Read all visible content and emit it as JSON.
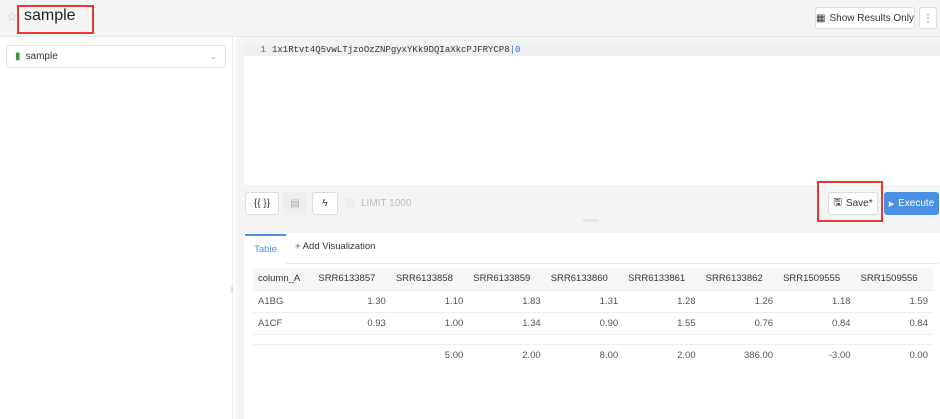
{
  "header": {
    "title": "sample",
    "show_results_label": "Show Results Only",
    "more_icon": "vertical-ellipsis"
  },
  "sidebar": {
    "dropdown_label": "sample"
  },
  "editor": {
    "line_number": "1",
    "code": "1x1Rtvt4Q5vwLTjzoOzZNPgyxYKk9DQIaXkcPJFRYCP8",
    "cursor_text": "0"
  },
  "toolbar": {
    "format_label": "{{ }}",
    "limit_label": "LIMIT 1000",
    "save_label": "Save*",
    "execute_label": "Execute"
  },
  "results": {
    "tabs": [
      {
        "label": "Table"
      },
      {
        "label": "Add Visualization"
      }
    ],
    "columns": [
      "column_A",
      "SRR6133857",
      "SRR6133858",
      "SRR6133859",
      "SRR6133860",
      "SRR6133861",
      "SRR6133862",
      "SRR1509555",
      "SRR1509556"
    ],
    "rows": [
      [
        "A1BG",
        "1.30",
        "1.10",
        "1.83",
        "1.31",
        "1.28",
        "1.26",
        "1.18",
        "1.59"
      ],
      [
        "A1CF",
        "0.93",
        "1.00",
        "1.34",
        "0.90",
        "1.55",
        "0.76",
        "0.84",
        "0.84"
      ],
      [
        "",
        "",
        "",
        "",
        "",
        "",
        "",
        "",
        ""
      ],
      [
        "",
        "",
        "5.00",
        "2.00",
        "8.00",
        "2.00",
        "386.00",
        "-3.00",
        "0.00"
      ]
    ]
  },
  "colors": {
    "accent": "#4a90e2",
    "highlight": "#e53b2c"
  }
}
